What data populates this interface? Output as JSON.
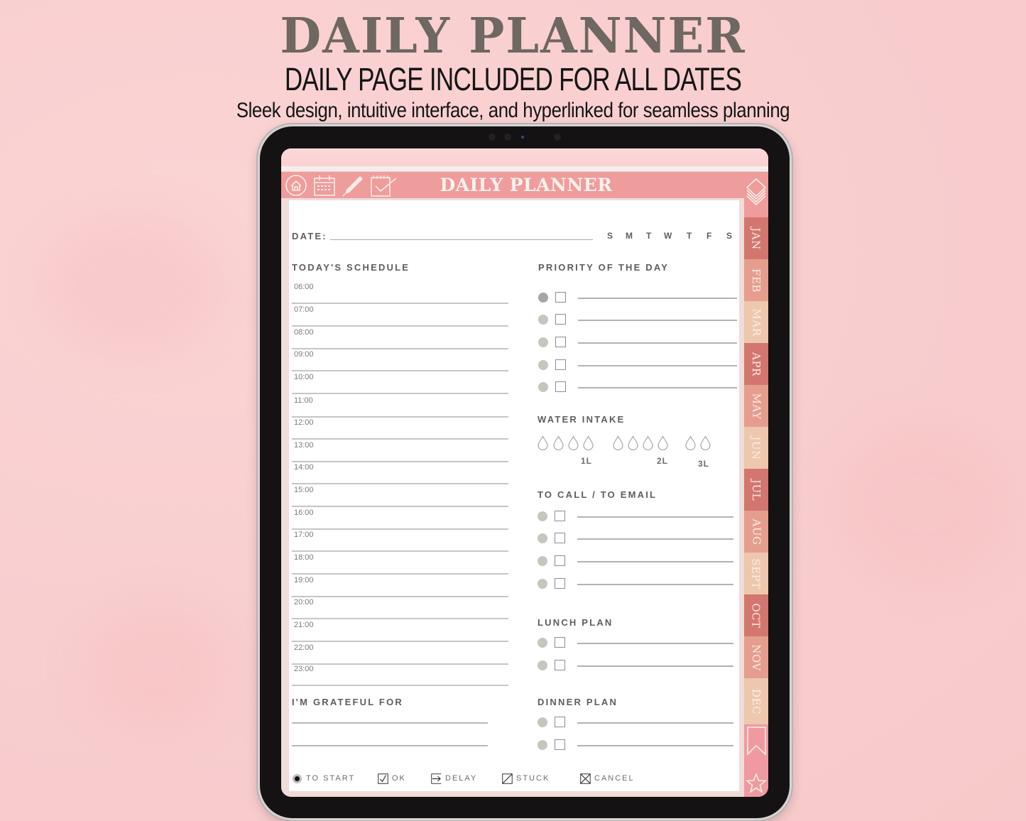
{
  "promo": {
    "title": "DAILY PLANNER",
    "subtitle": "DAILY PAGE INCLUDED FOR ALL DATES",
    "tagline": "Sleek design, intuitive interface, and hyperlinked for seamless planning"
  },
  "header": {
    "title": "DAILY PLANNER",
    "icons": [
      "home-icon",
      "calendar-icon",
      "pen-icon",
      "checklist-icon"
    ]
  },
  "colors": {
    "background": "#f9cfd0",
    "header": "#ef9c9c",
    "tab_dark": "#d3766f",
    "tab_mid": "#e59e8e",
    "tab_light": "#edc7ae",
    "text": "#5e5e5e",
    "dot": "#c5c6bc"
  },
  "date": {
    "label": "DATE:",
    "value": "",
    "weekdays": [
      "S",
      "M",
      "T",
      "W",
      "T",
      "F",
      "S"
    ]
  },
  "schedule": {
    "title": "TODAY'S SCHEDULE",
    "times": [
      "06:00",
      "07:00",
      "08:00",
      "09:00",
      "10:00",
      "11:00",
      "12:00",
      "13:00",
      "14:00",
      "15:00",
      "16:00",
      "17:00",
      "18:00",
      "19:00",
      "20:00",
      "21:00",
      "22:00",
      "23:00"
    ]
  },
  "priority": {
    "title": "PRIORITY OF THE DAY",
    "count": 5
  },
  "water": {
    "title": "WATER INTAKE",
    "groups": [
      4,
      4,
      2
    ],
    "labels": [
      "1L",
      "2L",
      "3L"
    ],
    "filled": 0
  },
  "calls": {
    "title": "TO CALL / TO EMAIL",
    "count": 4
  },
  "lunch": {
    "title": "LUNCH PLAN",
    "count": 2
  },
  "dinner": {
    "title": "DINNER PLAN",
    "count": 2
  },
  "grateful": {
    "title": "I'M GRATEFUL FOR",
    "lines": 2
  },
  "legend": [
    {
      "icon": "dot-icon",
      "label": "TO START"
    },
    {
      "icon": "check-box-icon",
      "label": "OK"
    },
    {
      "icon": "arrow-box-icon",
      "label": "DELAY"
    },
    {
      "icon": "slash-box-icon",
      "label": "STUCK"
    },
    {
      "icon": "x-box-icon",
      "label": "CANCEL"
    }
  ],
  "months": [
    "JAN",
    "FEB",
    "MAR",
    "APR",
    "MAY",
    "JUN",
    "JUL",
    "AUG",
    "SEPT",
    "OCT",
    "NOV",
    "DEC"
  ],
  "side_icons": [
    "layers-icon",
    "bookmark-icon",
    "star-icon"
  ]
}
